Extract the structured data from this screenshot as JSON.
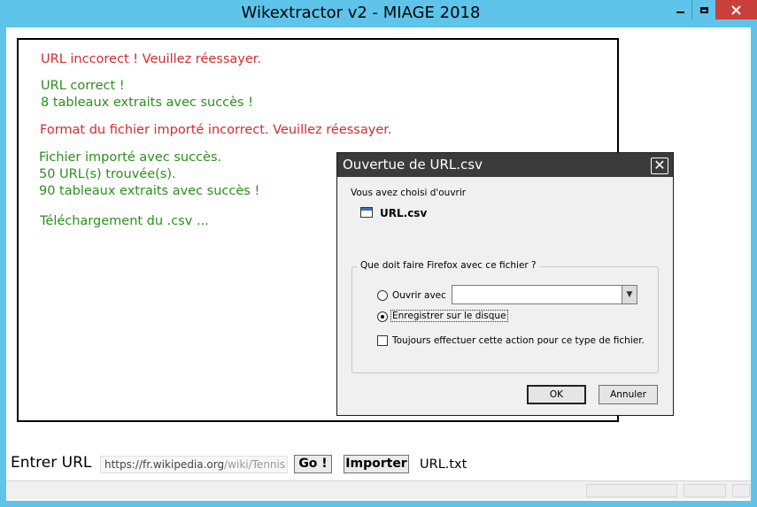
{
  "window": {
    "title": "Wikextractor v2 - MIAGE 2018"
  },
  "messages": [
    {
      "text": "URL inccorect ! Veuillez réessayer.",
      "color": "#d42b2b"
    },
    {
      "text": "URL correct !",
      "color": "#2c8f1c"
    },
    {
      "text": "8 tableaux extraits avec succès !",
      "color": "#2c8f1c"
    },
    {
      "text": "Format du fichier importé incorrect. Veuillez réessayer.",
      "color": "#d42b2b"
    },
    {
      "text": "Fichier importé avec succès.",
      "color": "#2c8f1c"
    },
    {
      "text": "50 URL(s) trouvée(s).",
      "color": "#2c8f1c"
    },
    {
      "text": "90 tableaux extraits avec succès !",
      "color": "#2c8f1c"
    },
    {
      "text": "Téléchargement du .csv ...",
      "color": "#2c8f1c"
    }
  ],
  "bottom": {
    "url_label": "Entrer URL",
    "url_value_prefix": "https://fr.wikipedia.org",
    "url_value_suffix": "/wiki/Tennis",
    "go_label": "Go !",
    "import_label": "Importer",
    "file_label": "URL.txt"
  },
  "dialog": {
    "title": "Ouvertue de URL.csv",
    "intro": "Vous avez choisi d'ouvrir",
    "file_name": "URL.csv",
    "group_legend": "Que doit faire Firefox avec ce fichier ?",
    "open_with_label": "Ouvrir avec",
    "save_label": "Enregistrer sur le disque",
    "always_label": "Toujours effectuer cette action pour ce type de fichier.",
    "ok_label": "OK",
    "cancel_label": "Annuler",
    "selected_option": "save",
    "always_checked": false
  }
}
